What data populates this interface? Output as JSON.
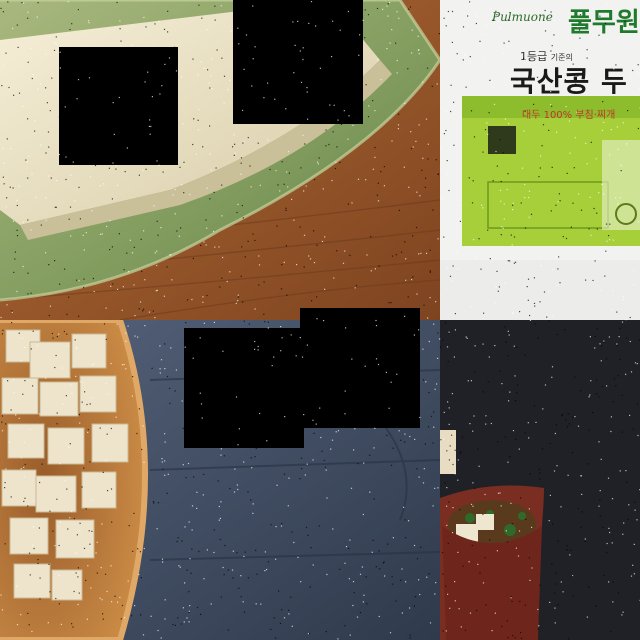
{
  "package": {
    "brand_en": "Pulmuone",
    "brand_ko": "풀무원",
    "grade": "1등급",
    "small_caption": "기준의",
    "product_name": "국산콩 두",
    "subtitle": "대두 100% 부침·찌개"
  },
  "colors": {
    "wood": "#9a5a2e",
    "plate_green": "#7f9a5c",
    "tofu": "#efe6cf",
    "package_green": "#a6cf3a",
    "slate": "#3f4a5c",
    "bowl": "#b5783d",
    "dark_bg": "#1f2127",
    "cup": "#7a2e22"
  }
}
